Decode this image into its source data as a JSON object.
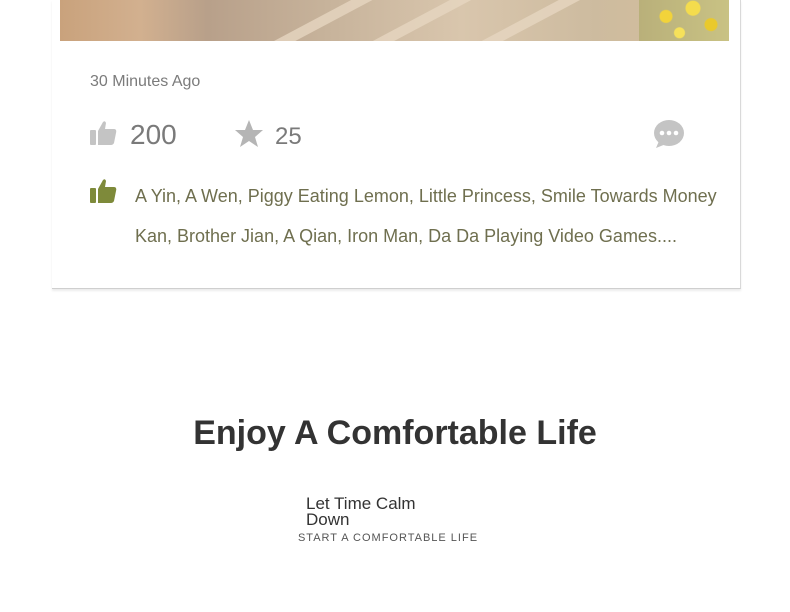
{
  "post": {
    "time": "30 Minutes Ago",
    "likes": "200",
    "favorites": "25",
    "likers": "A Yin, A Wen, Piggy Eating Lemon, Little Princess, Smile Towards Money Kan, Brother Jian, A Qian, Iron Man, Da Da Playing Video Games...."
  },
  "icons": {
    "like": "thumbs-up-icon",
    "favorite": "star-icon",
    "comment": "comment-bubble-icon",
    "likers": "thumbs-up-icon"
  },
  "colors": {
    "icon_gray": "#c4c4c4",
    "likers_green": "#7e8a3a",
    "likers_text": "#6f6f4f"
  },
  "section": {
    "title": "Enjoy A Comfortable Life",
    "subtitle": "Let Time Calm Down",
    "tagline": "START A COMFORTABLE LIFE"
  }
}
